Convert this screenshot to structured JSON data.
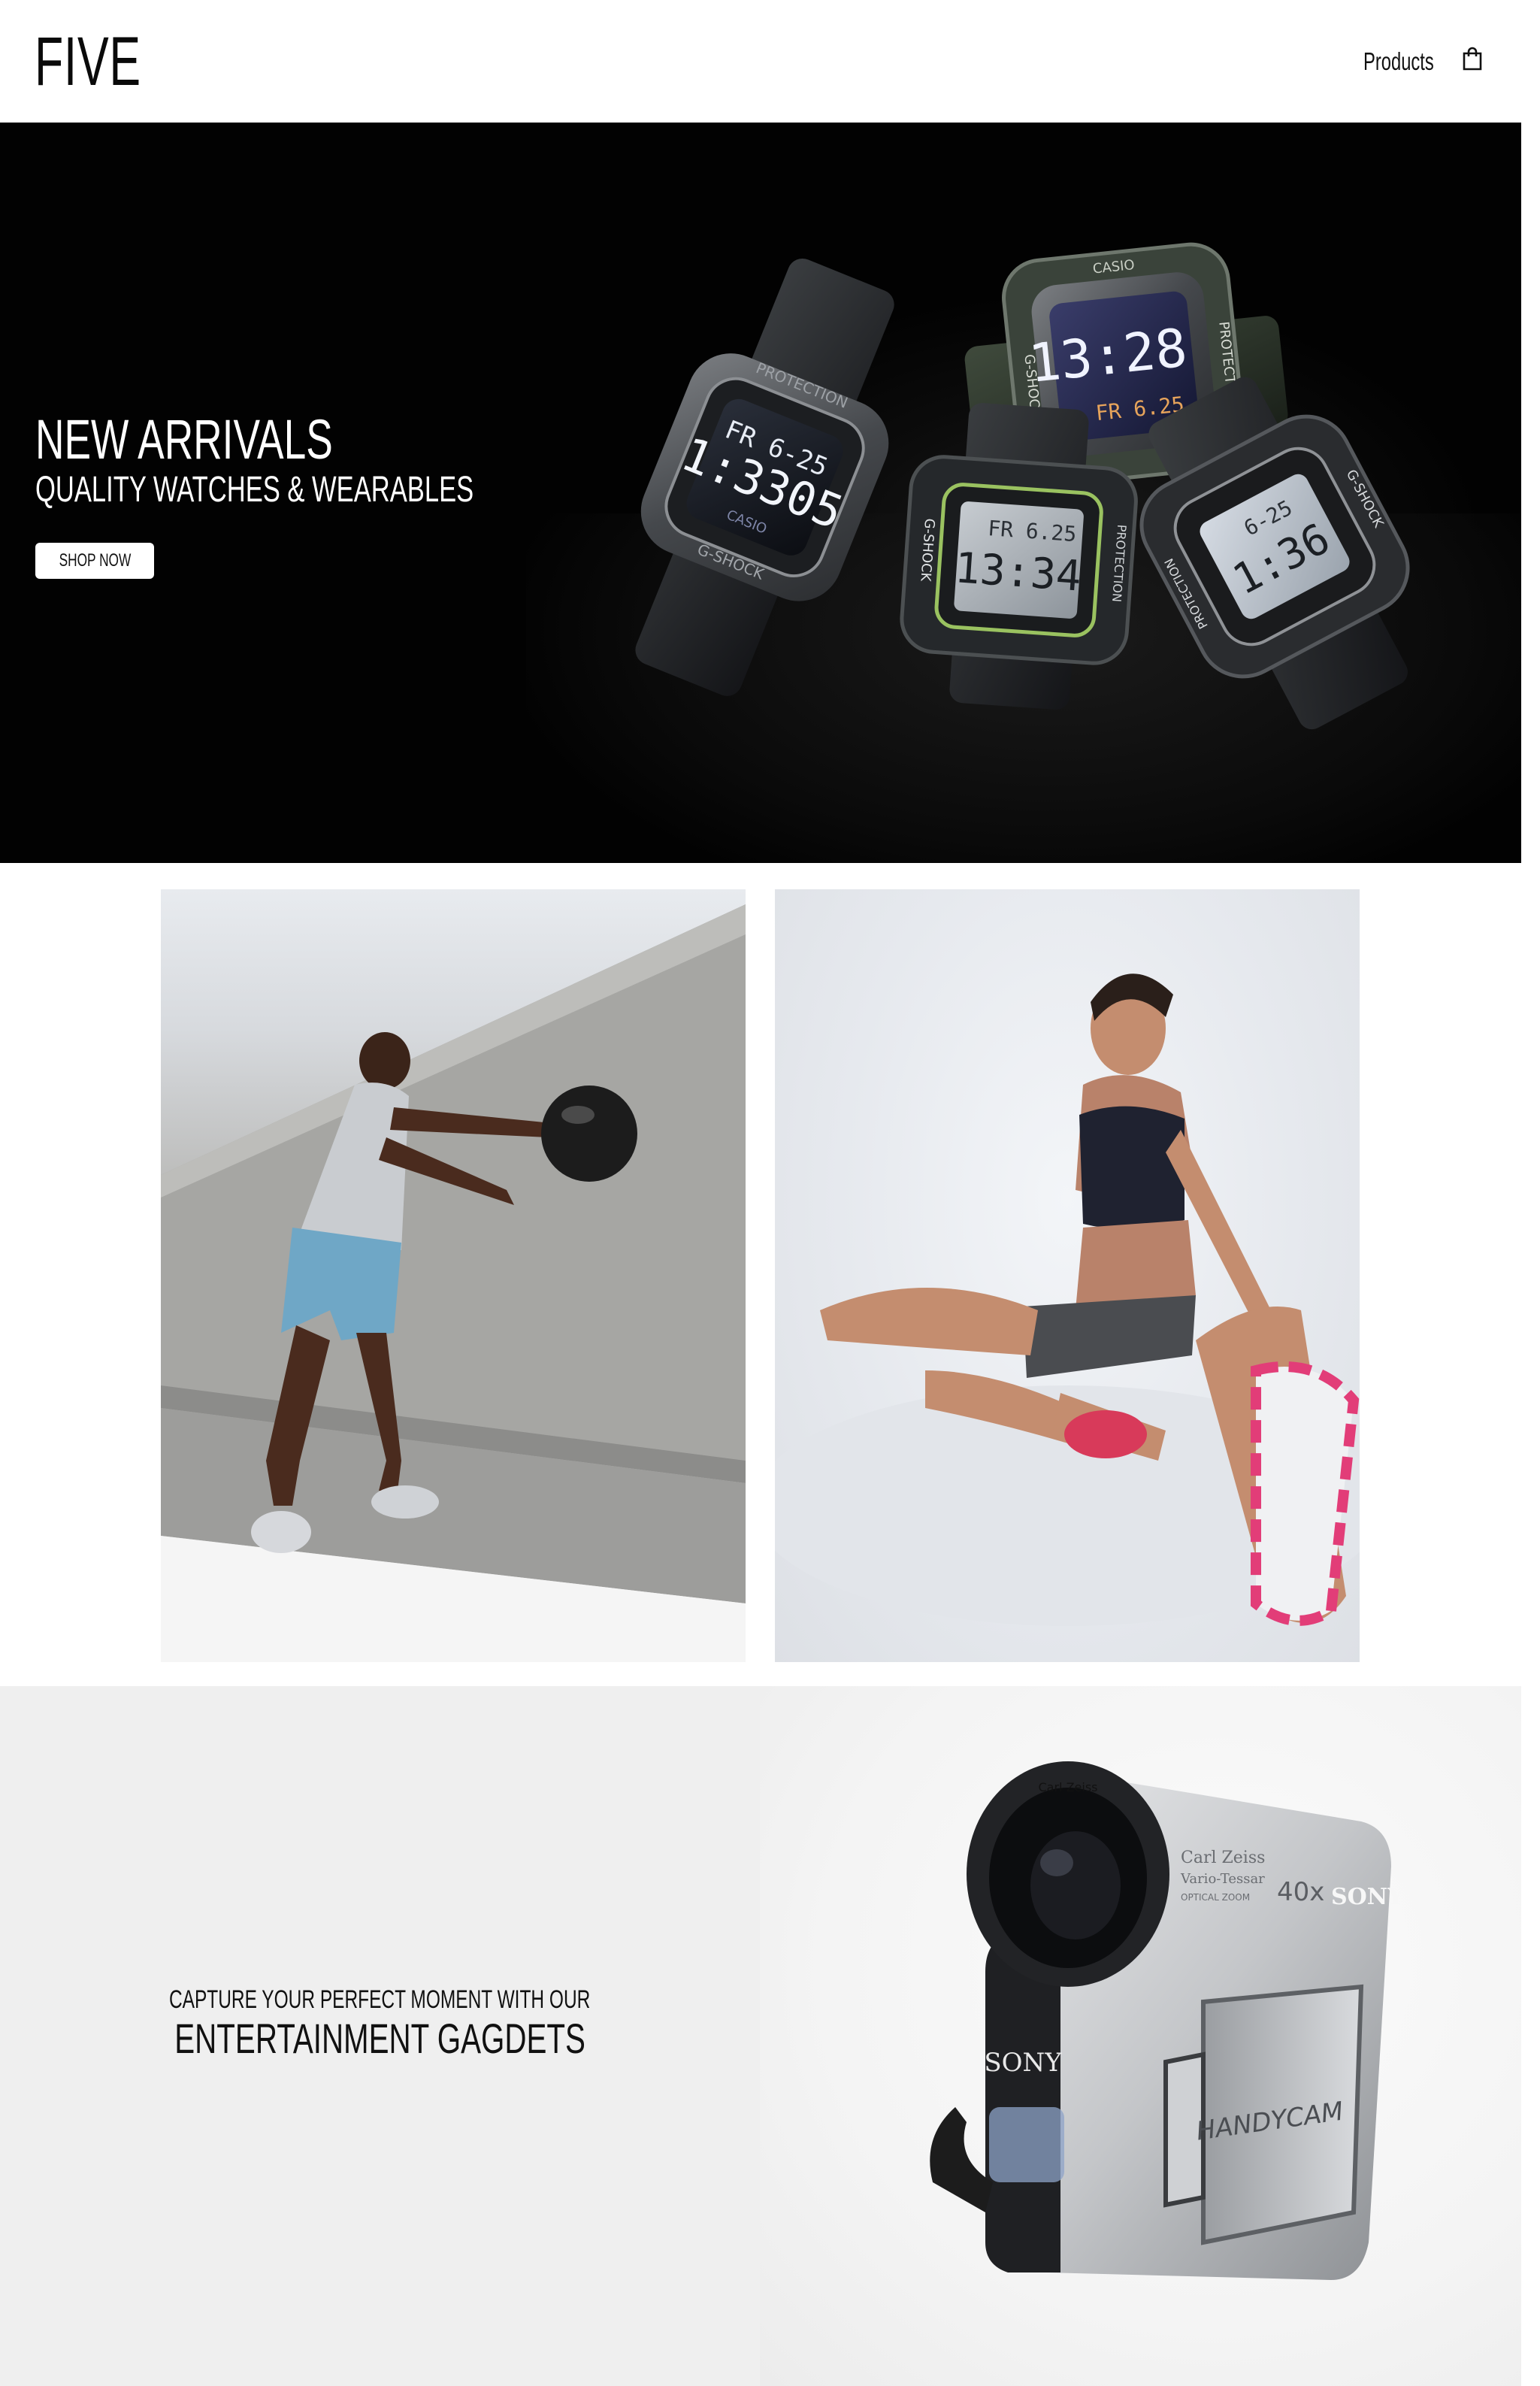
{
  "header": {
    "logo": "FIVE",
    "nav": {
      "products_label": "Products"
    },
    "cart_icon": "shopping-bag-icon"
  },
  "hero": {
    "title": "NEW ARRIVALS",
    "subtitle": "QUALITY WATCHES & WEARABLES",
    "cta_label": "SHOP NOW",
    "image": "g-shock-watches-photo",
    "watch_texts": {
      "w1_top": "PROTECTION",
      "w1_display1": "FR  6-25",
      "w1_display2": "1:3305",
      "w1_brand": "CASIO",
      "w1_side": "G-SHOCK",
      "w2_top": "CASIO",
      "w2_display1": "13:28",
      "w2_display2": "FR 6.25",
      "w2_side1": "G-SHOCK",
      "w2_side2": "PROTECTION",
      "w3_display1": "FR 6.25",
      "w3_display2": "13:34",
      "w3_side1": "G-SHOCK",
      "w3_side2": "PROTECTION",
      "w4_display1": "6-25",
      "w4_display2": "1:36",
      "w4_side1": "PROTECTION",
      "w4_side2": "G-SHOCK"
    }
  },
  "gallery": {
    "left_image": "man-medicine-ball-photo",
    "right_image": "woman-stretching-photo"
  },
  "gadgets": {
    "kicker": "CAPTURE YOUR PERFECT MOMENT WITH OUR",
    "title": "ENTERTAINMENT GAGDETS",
    "image": "sony-handycam-photo",
    "camera_texts": {
      "lens_ring": "Carl Zeiss",
      "lens_line1": "Carl Zeiss",
      "lens_line2": "Vario-Tessar",
      "lens_line3": "OPTICAL ZOOM",
      "zoom": "40x",
      "brand_top": "SONY",
      "brand_front": "SONY",
      "model": "HANDYCAM"
    }
  },
  "colors": {
    "background": "#ffffff",
    "hero_background": "#050505",
    "gadget_panel": "#efefef",
    "text": "#111111",
    "button_bg": "#ffffff"
  }
}
